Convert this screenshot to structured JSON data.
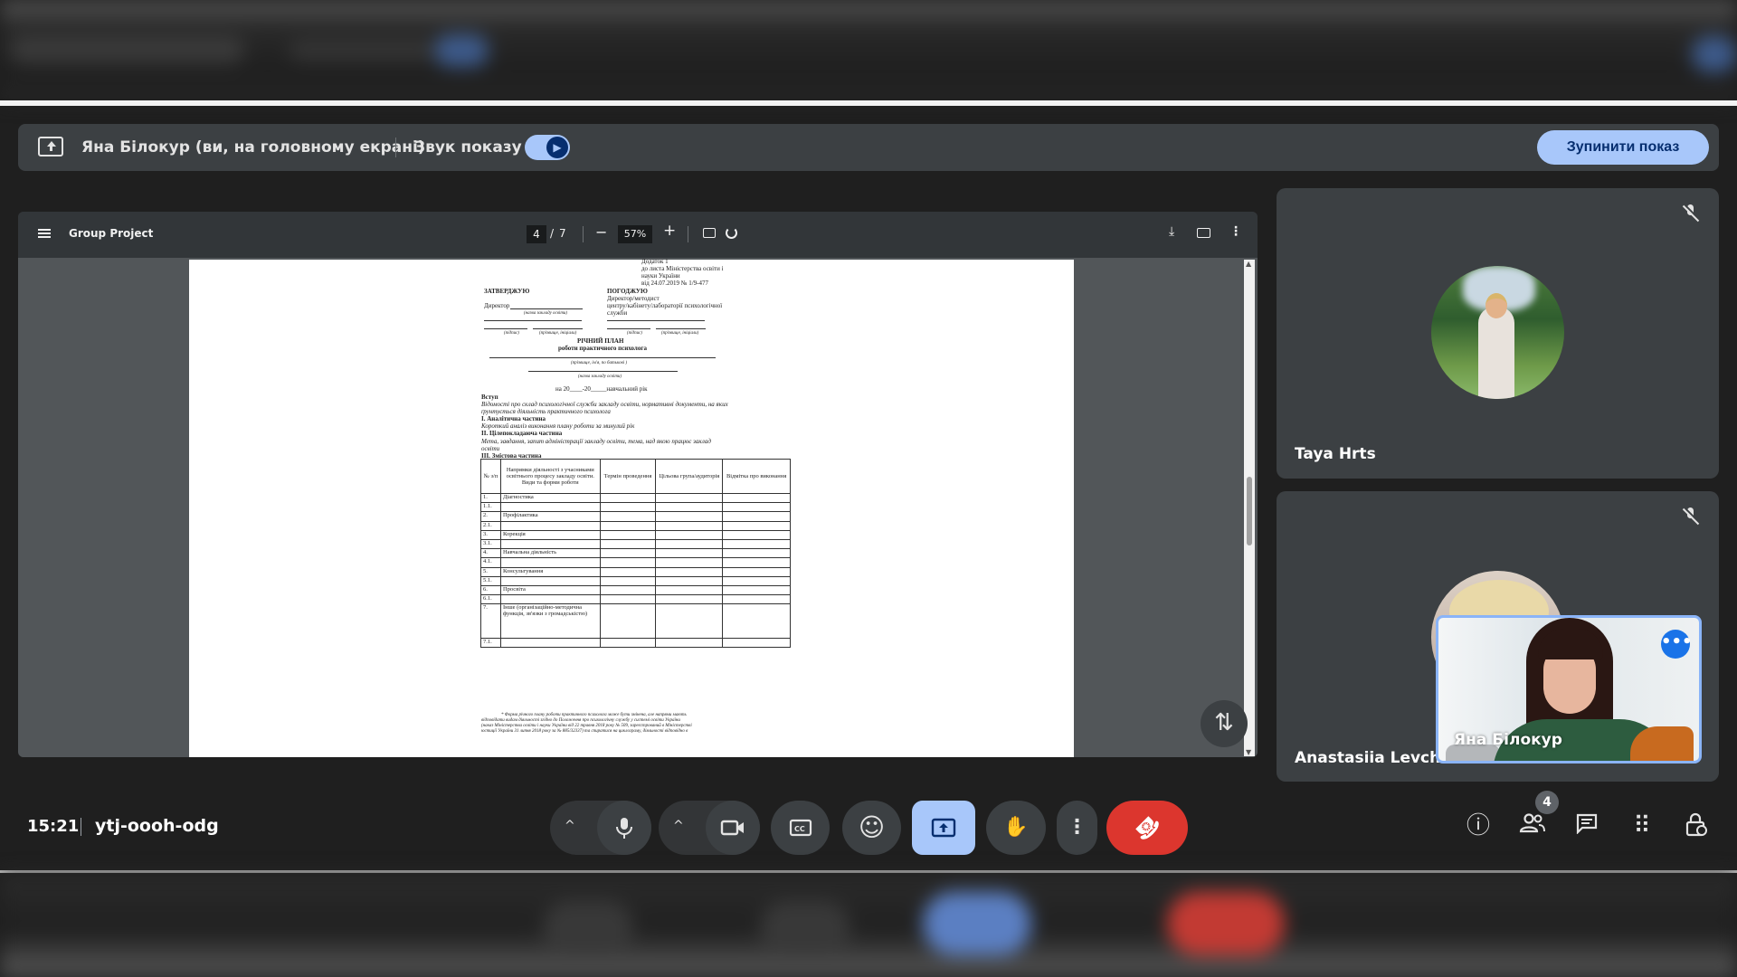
{
  "share_bar": {
    "title": "Яна Білокур (ви, на головному екрані)",
    "sound_label": "Звук показу",
    "sound_on": true,
    "stop_label": "Зупинити показ"
  },
  "pdf": {
    "title": "Group Project",
    "page": "4",
    "page_sep": "/",
    "total_pages": "7",
    "zoom": "57%",
    "zoom_out": "−",
    "zoom_in": "+",
    "download_icon": "⤓",
    "more_icon": "⋮",
    "doc": {
      "appendix": [
        "Додаток 1",
        "до листа Міністерства освіти і",
        "науки України"
      ],
      "date_line": "від  24.07.2019     № 1/9-477",
      "approve": "ЗАТВЕРДЖУЮ",
      "agree": "ПОГОДЖУЮ",
      "director": "Директор",
      "director_agree": [
        "Директор/методист",
        "центру/кабінету/лабораторії психологічної",
        "служби"
      ],
      "school_caption": "(назва закладу освіти)",
      "sign": "(підпис)",
      "name_caption": "(прізвище, ініціали)",
      "plan_title": "РІЧНИЙ ПЛАН",
      "plan_subtitle": "роботи практичного психолога",
      "fio_caption": "(прізвище, ім'я, по батькові )",
      "school_caption2": "(назва закладу освіти)",
      "year_line": "на 20____-20_____навчальний рік",
      "intro": "Вступ",
      "intro_text": [
        "Відомості про склад психологічної служби закладу освіти, нормативні документи, на яких",
        "ґрунтується діяльність практичного психолога"
      ],
      "part1": "І. Аналітична частина",
      "part1_text": "Короткий аналіз виконання плану роботи за минулий рік",
      "part2": "ІІ. Цілепокладаюча частина",
      "part2_text": [
        "Мета, завдання, запит адміністрації закладу освіти, тема, над якою працює заклад",
        "освіти"
      ],
      "part3": "ІІІ. Змістова частина",
      "table_headers": [
        "№ з/п",
        "Напрямки діяльності з учасниками освітнього процесу закладу освіти. Види та форми роботи",
        "Термін проведення",
        "Цільова група/аудиторія",
        "Відмітка про виконання"
      ],
      "table_rows": [
        [
          "1.",
          "Діагностика"
        ],
        [
          "1.1.",
          ""
        ],
        [
          "2.",
          "Профілактика"
        ],
        [
          "2.1.",
          ""
        ],
        [
          "3.",
          "Корекція"
        ],
        [
          "3.1.",
          ""
        ],
        [
          "4.",
          "Навчальна діяльність"
        ],
        [
          "4.1.",
          ""
        ],
        [
          "5.",
          "Консультування"
        ],
        [
          "5.1.",
          ""
        ],
        [
          "6.",
          "Просвіта"
        ],
        [
          "6.1.",
          ""
        ],
        [
          "7.",
          "Інше (організаційно-методична функція, зв'язки з громадськістю)"
        ],
        [
          "7.1.",
          ""
        ]
      ],
      "footnote": [
        "* Форма річного плану роботи практичного психолога може бути змінена, але напрями мають",
        "відповідати видам діяльності згідно до Положення про психологічну службу у системі освіти України",
        "(наказ Міністерства освіти і науки України від 22 травня 2018 року № 509, зареєстрований в Міністерстві",
        "юстиції України 31 липня 2018 року за № 885/32337) та спиратися на циклограму, діяльності відповідно в"
      ]
    }
  },
  "participants": [
    {
      "name": "Taya Hrts",
      "muted": true
    },
    {
      "name": "Anastasiia Levchen",
      "muted": true
    }
  ],
  "self_view": {
    "name": "Яна Білокур",
    "more_icon": "•••"
  },
  "controls": {
    "time": "15:21",
    "meeting_code": "ytj-oooh-odg",
    "caret": "^",
    "people_count": "4",
    "hand_icon": "✋",
    "emoji_icon": "☺",
    "more_icon": "⋮",
    "info_icon": "ⓘ",
    "apps_icon": "⠿",
    "leave_icon": "☎"
  },
  "colors": {
    "accent": "#a8c7fa",
    "leave": "#dc362e",
    "tile": "#3c4043",
    "background": "#1f1f1f"
  }
}
